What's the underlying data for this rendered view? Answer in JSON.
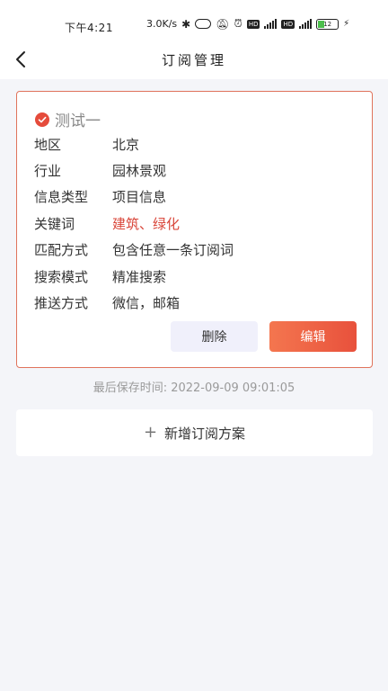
{
  "status_bar": {
    "time": "下午4:21",
    "speed": "3.0K/s",
    "battery": "12"
  },
  "nav": {
    "title": "订阅管理",
    "back_icon": "chevron-left-icon"
  },
  "subscription": {
    "name": "测试一",
    "selected": true,
    "fields": [
      {
        "label": "地区",
        "value": "北京",
        "highlight": false
      },
      {
        "label": "行业",
        "value": "园林景观",
        "highlight": false
      },
      {
        "label": "信息类型",
        "value": "项目信息",
        "highlight": false
      },
      {
        "label": "关键词",
        "value": "建筑、绿化",
        "highlight": true
      },
      {
        "label": "匹配方式",
        "value": "包含任意一条订阅词",
        "highlight": false
      },
      {
        "label": "搜索模式",
        "value": "精准搜索",
        "highlight": false
      },
      {
        "label": "推送方式",
        "value": "微信，邮箱",
        "highlight": false
      }
    ],
    "delete_label": "删除",
    "edit_label": "编辑"
  },
  "saved_time": "最后保存时间: 2022-09-09 09:01:05",
  "add_plan_label": "新增订阅方案",
  "colors": {
    "accent": "#e8513c",
    "highlight_text": "#d9463a",
    "card_border": "#e0735c"
  }
}
